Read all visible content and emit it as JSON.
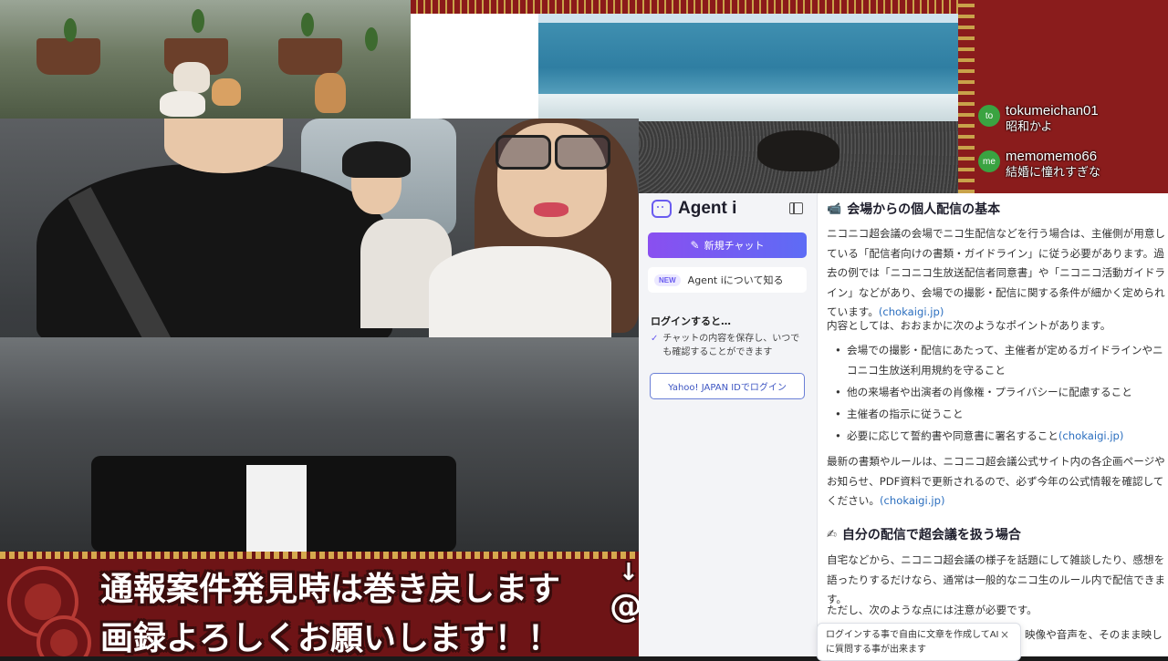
{
  "chat": [
    {
      "avatar": "to",
      "user": "tokumeichan01",
      "message": "昭和かよ"
    },
    {
      "avatar": "me",
      "user": "memomemo66",
      "message": "結婚に憧れすぎな"
    }
  ],
  "banner": {
    "line1": "通報案件発見時は巻き戻します",
    "line2": "画録よろしくお願いします！！",
    "side_glyph1": "↓",
    "side_glyph2": "@"
  },
  "sidebar": {
    "logo": "Agent i",
    "new_chat_label": "新規チャット",
    "about_badge": "NEW",
    "about_label": "Agent iについて知る",
    "login_heading": "ログインすると…",
    "login_benefit": "チャットの内容を保存し、いつでも確認することができます",
    "login_button": "Yahoo! JAPAN IDでログイン"
  },
  "content": {
    "section1_title": "会場からの個人配信の基本",
    "para1": "ニコニコ超会議の会場でニコ生配信などを行う場合は、主催側が用意している「配信者向けの書類・ガイドライン」に従う必要があります。過去の例では「ニコニコ生放送配信者同意書」や「ニコニコ活動ガイドライン」などがあり、会場での撮影・配信に関する条件が細かく定められています。",
    "source": "(chokaigi.jp)",
    "para2": "内容としては、おおまかに次のようなポイントがあります。",
    "bullets": [
      "会場での撮影・配信にあたって、主催者が定めるガイドラインやニコニコ生放送利用規約を守ること",
      "他の来場者や出演者の肖像権・プライバシーに配慮すること",
      "主催者の指示に従うこと",
      "必要に応じて誓約書や同意書に署名すること"
    ],
    "para3": "最新の書類やルールは、ニコニコ超会議公式サイト内の各企画ページやお知らせ、PDF資料で更新されるので、必ず今年の公式情報を確認してください。",
    "section2_title": "自分の配信で超会議を扱う場合",
    "para4": "自宅などから、ニコニコ超会議の様子を話題にして雑談したり、感想を語ったりするだけなら、通常は一般的なニコ生のルール内で配信できます。",
    "para5": "ただし、次のような点には注意が必要です。",
    "partial_line": "映像や音声を、そのまま映し"
  },
  "toast": {
    "text": "ログインする事で自由に文章を作成してAIに質問する事が出来ます",
    "close": "×"
  },
  "colors": {
    "accent": "#6a5cf0",
    "link": "#2c6fbf",
    "chat_avatar": "#3aa341",
    "banner_bg": "#6e1416"
  }
}
